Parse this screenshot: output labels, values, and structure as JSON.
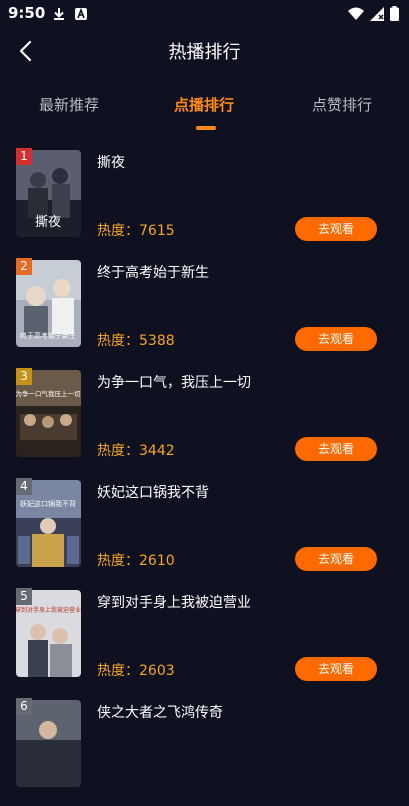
{
  "status": {
    "time": "9:50"
  },
  "header": {
    "title": "热播排行"
  },
  "tabs": [
    {
      "label": "最新推荐",
      "active": false
    },
    {
      "label": "点播排行",
      "active": true
    },
    {
      "label": "点赞排行",
      "active": false
    }
  ],
  "list": [
    {
      "rank": "1",
      "title": "撕夜",
      "heat": "热度：7615",
      "button": "去观看",
      "poster_text": "撕夜",
      "badge_color": "#d32f2f",
      "poster_colors": [
        "#5a5e70",
        "#1c1f2a"
      ]
    },
    {
      "rank": "2",
      "title": "终于高考始于新生",
      "heat": "热度：5388",
      "button": "去观看",
      "poster_text": "终于高考始于新生",
      "badge_color": "#e66a22",
      "poster_colors": [
        "#c7cdd4",
        "#6a7480"
      ]
    },
    {
      "rank": "3",
      "title": "为争一口气，我压上一切",
      "heat": "热度：3442",
      "button": "去观看",
      "poster_text": "为争一口气我压上一切",
      "badge_color": "#c79017",
      "poster_colors": [
        "#6b5a48",
        "#2a221c"
      ]
    },
    {
      "rank": "4",
      "title": "妖妃这口锅我不背",
      "heat": "热度：2610",
      "button": "去观看",
      "poster_text": "妖妃这口锅我不背",
      "badge_color": "#666a73",
      "poster_colors": [
        "#7b86a3",
        "#3b3f58"
      ]
    },
    {
      "rank": "5",
      "title": "穿到对手身上我被迫营业",
      "heat": "热度：2603",
      "button": "去观看",
      "poster_text": "穿到对手身上我被迫营业",
      "badge_color": "#666a73",
      "poster_colors": [
        "#d9dbe0",
        "#a0a5b0"
      ]
    },
    {
      "rank": "6",
      "title": "侠之大者之飞鸿传奇",
      "heat": "",
      "button": "",
      "poster_text": "",
      "badge_color": "#666a73",
      "poster_colors": [
        "#5d6470",
        "#2a2e38"
      ]
    }
  ]
}
